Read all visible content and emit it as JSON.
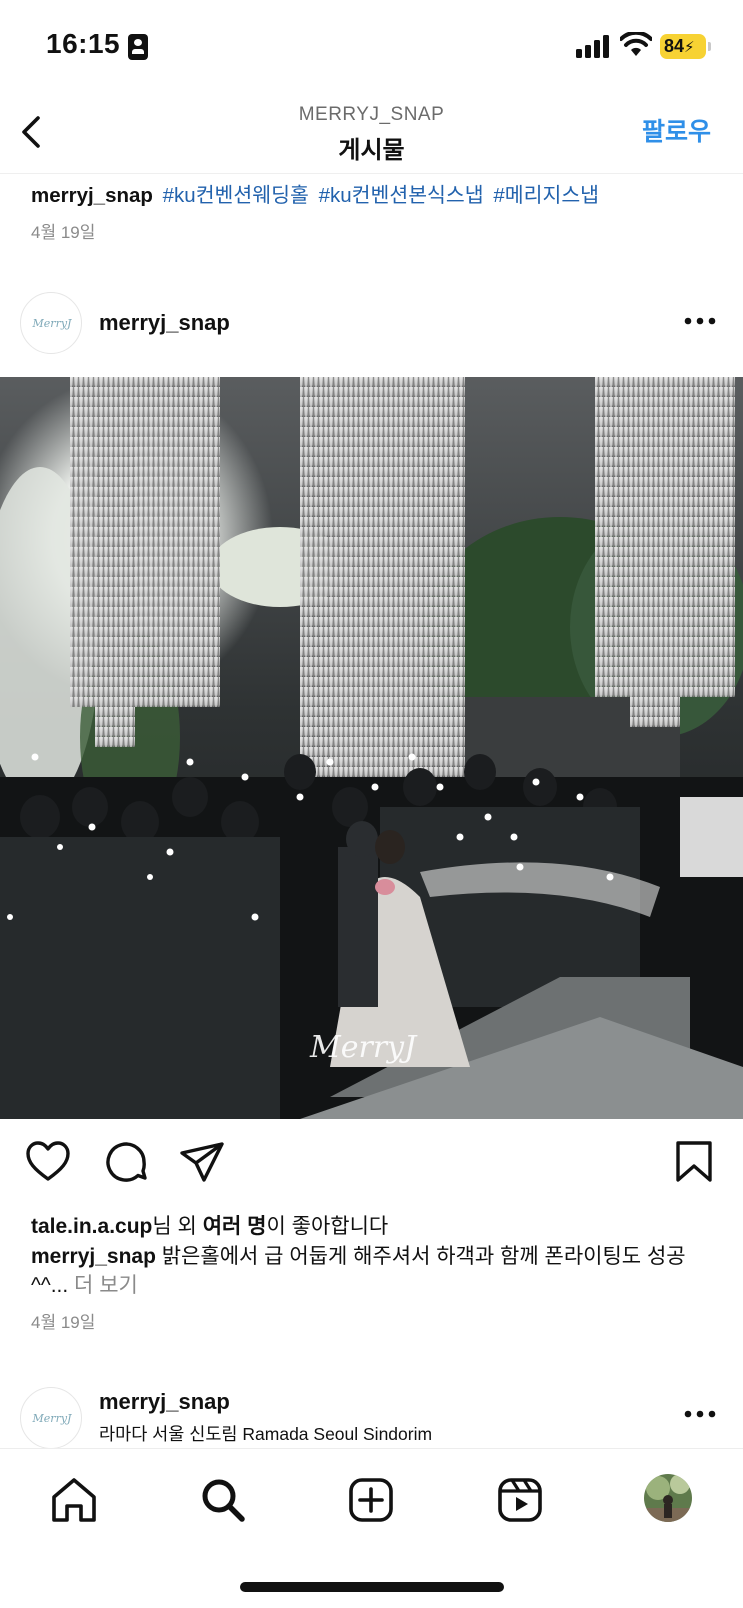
{
  "status_bar": {
    "time": "16:15",
    "battery": "84"
  },
  "header": {
    "subtitle": "MERRYJ_SNAP",
    "title": "게시물",
    "follow_label": "팔로우"
  },
  "prev_post": {
    "username": "merryj_snap",
    "hashtags": [
      "#ku컨벤션웨딩홀",
      "#ku컨벤션본식스냅",
      "#메리지스냅"
    ],
    "date": "4월 19일"
  },
  "post": {
    "username": "merryj_snap",
    "avatar_text": "MerryJ",
    "image_watermark": "MerryJ",
    "liked_by": "tale.in.a.cup",
    "likes_suffix_1": "님 외 ",
    "likes_bold": "여러 명",
    "likes_suffix_2": "이 좋아합니다",
    "caption_user": "merryj_snap",
    "caption_text": " 밝은홀에서 급 어둡게 해주셔서 하객과 함께 폰라이팅도 성공^^...",
    "more_label": " 더 보기",
    "date": "4월 19일"
  },
  "next_post": {
    "username": "merryj_snap",
    "location": "라마다 서울 신도림 Ramada Seoul Sindorim"
  },
  "icons": {
    "back": "chevron-left-icon",
    "more": "ellipsis-icon",
    "like": "heart-icon",
    "comment": "comment-icon",
    "share": "send-icon",
    "save": "bookmark-icon",
    "home": "home-icon",
    "search": "search-icon",
    "create": "plus-square-icon",
    "reels": "reels-icon",
    "profile": "profile-avatar"
  }
}
